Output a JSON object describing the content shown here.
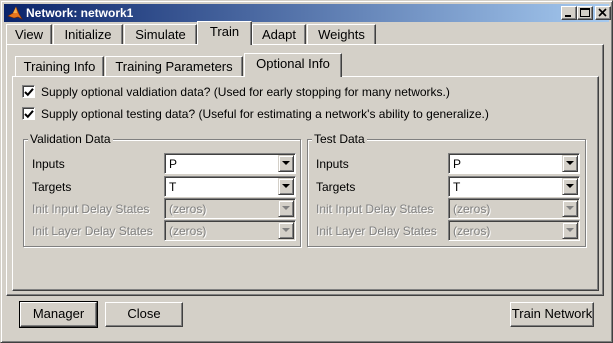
{
  "window": {
    "title": "Network: network1",
    "accent": "#0a246a"
  },
  "main_tabs": [
    {
      "label": "View"
    },
    {
      "label": "Initialize"
    },
    {
      "label": "Simulate"
    },
    {
      "label": "Train",
      "active": true
    },
    {
      "label": "Adapt"
    },
    {
      "label": "Weights"
    }
  ],
  "sub_tabs": [
    {
      "label": "Training Info"
    },
    {
      "label": "Training Parameters"
    },
    {
      "label": "Optional Info",
      "active": true
    }
  ],
  "options": {
    "validation": {
      "checked": true,
      "label": "Supply optional valdiation data? (Used for early stopping for many networks.)"
    },
    "testing": {
      "checked": true,
      "label": "Supply optional testing data? (Useful for estimating a network's ability to generalize.)"
    }
  },
  "validation_group": {
    "title": "Validation Data",
    "inputs_label": "Inputs",
    "inputs_value": "P",
    "targets_label": "Targets",
    "targets_value": "T",
    "init_input_label": "Init Input Delay States",
    "init_input_value": "(zeros)",
    "init_layer_label": "Init Layer Delay States",
    "init_layer_value": "(zeros)"
  },
  "test_group": {
    "title": "Test Data",
    "inputs_label": "Inputs",
    "inputs_value": "P",
    "targets_label": "Targets",
    "targets_value": "T",
    "init_input_label": "Init Input Delay States",
    "init_input_value": "(zeros)",
    "init_layer_label": "Init Layer Delay States",
    "init_layer_value": "(zeros)"
  },
  "buttons": {
    "manager": "Manager",
    "close": "Close",
    "train_network": "Train Network"
  }
}
